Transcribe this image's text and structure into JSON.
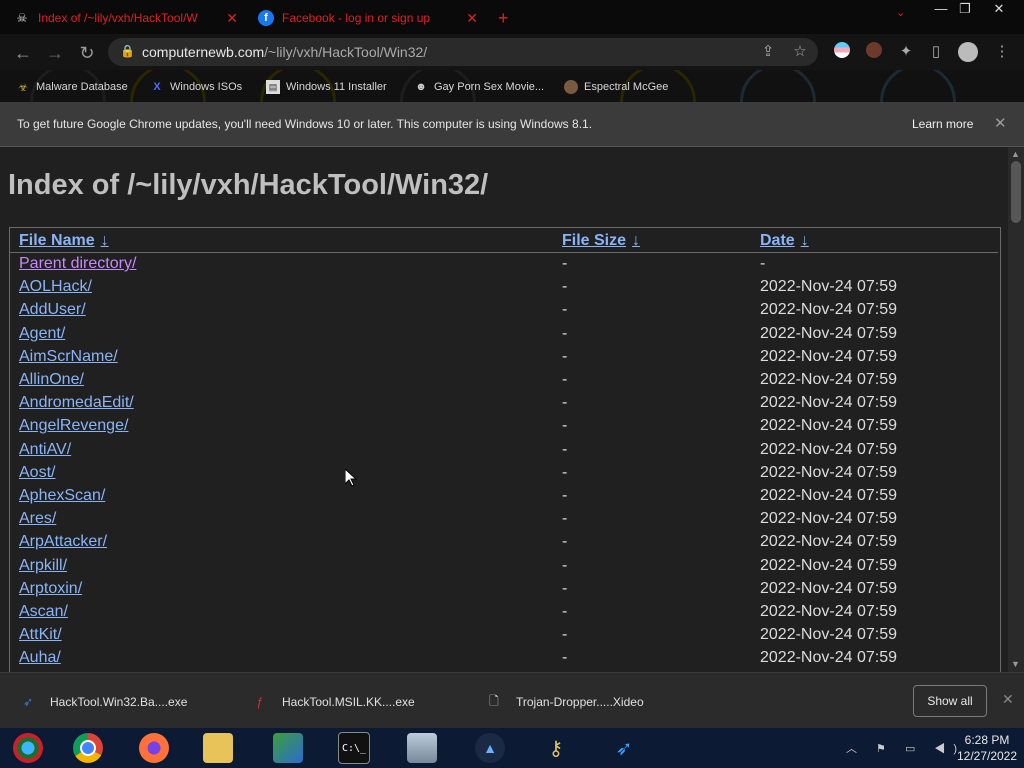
{
  "tabs": [
    {
      "title": "Index of /~lily/vxh/HackTool/W",
      "icon": "skull-icon"
    },
    {
      "title": "Facebook - log in or sign up",
      "icon": "facebook-icon"
    }
  ],
  "new_tab_symbol": "+",
  "window_controls": {
    "minimize": "—",
    "restore": "❐",
    "close": "✕"
  },
  "address": {
    "host": "computernewb.com",
    "path": "/~lily/vxh/HackTool/Win32/"
  },
  "bookmarks": [
    {
      "label": "Malware Database",
      "icon": "hazard-icon"
    },
    {
      "label": "Windows ISOs",
      "icon": "x-icon"
    },
    {
      "label": "Windows 11 Installer",
      "icon": "installer-icon"
    },
    {
      "label": "Gay Porn Sex Movie...",
      "icon": "mascot-icon"
    },
    {
      "label": "Espectral McGee",
      "icon": "avatar-icon"
    }
  ],
  "infobar": {
    "message": "To get future Google Chrome updates, you'll need Windows 10 or later. This computer is using Windows 8.1.",
    "link": "Learn more",
    "close": "✕"
  },
  "page": {
    "title": "Index of /~lily/vxh/HackTool/Win32/",
    "columns": {
      "name": "File Name",
      "size": "File Size",
      "date": "Date",
      "sort_arrow": "↓"
    },
    "rows": [
      {
        "name": "Parent directory/",
        "size": "-",
        "date": "-"
      },
      {
        "name": "AOLHack/",
        "size": "-",
        "date": "2022-Nov-24 07:59"
      },
      {
        "name": "AddUser/",
        "size": "-",
        "date": "2022-Nov-24 07:59"
      },
      {
        "name": "Agent/",
        "size": "-",
        "date": "2022-Nov-24 07:59"
      },
      {
        "name": "AimScrName/",
        "size": "-",
        "date": "2022-Nov-24 07:59"
      },
      {
        "name": "AllinOne/",
        "size": "-",
        "date": "2022-Nov-24 07:59"
      },
      {
        "name": "AndromedaEdit/",
        "size": "-",
        "date": "2022-Nov-24 07:59"
      },
      {
        "name": "AngelRevenge/",
        "size": "-",
        "date": "2022-Nov-24 07:59"
      },
      {
        "name": "AntiAV/",
        "size": "-",
        "date": "2022-Nov-24 07:59"
      },
      {
        "name": "Aost/",
        "size": "-",
        "date": "2022-Nov-24 07:59"
      },
      {
        "name": "AphexScan/",
        "size": "-",
        "date": "2022-Nov-24 07:59"
      },
      {
        "name": "Ares/",
        "size": "-",
        "date": "2022-Nov-24 07:59"
      },
      {
        "name": "ArpAttacker/",
        "size": "-",
        "date": "2022-Nov-24 07:59"
      },
      {
        "name": "Arpkill/",
        "size": "-",
        "date": "2022-Nov-24 07:59"
      },
      {
        "name": "Arptoxin/",
        "size": "-",
        "date": "2022-Nov-24 07:59"
      },
      {
        "name": "Ascan/",
        "size": "-",
        "date": "2022-Nov-24 07:59"
      },
      {
        "name": "AttKit/",
        "size": "-",
        "date": "2022-Nov-24 07:59"
      },
      {
        "name": "Auha/",
        "size": "-",
        "date": "2022-Nov-24 07:59"
      }
    ]
  },
  "downloads": [
    {
      "label": "HackTool.Win32.Ba....exe",
      "icon": "bird-icon"
    },
    {
      "label": "HackTool.MSIL.KK....exe",
      "icon": "flash-icon"
    },
    {
      "label": "Trojan-Dropper.....Xideo",
      "icon": "file-icon"
    }
  ],
  "downloads_show_all": "Show all",
  "downloads_close": "✕",
  "taskbar": {
    "apps": [
      "start-icon",
      "chrome-icon",
      "firefox-icon",
      "file-explorer-icon",
      "network-icon",
      "cmd-icon",
      "system-icon",
      "flame-app-icon",
      "keys-icon",
      "bird-app-icon"
    ],
    "cmd_label": "C:\\_",
    "time": "6:28 PM",
    "date": "12/27/2022",
    "tray": "︿ ⚑ ▭ ◀)"
  }
}
